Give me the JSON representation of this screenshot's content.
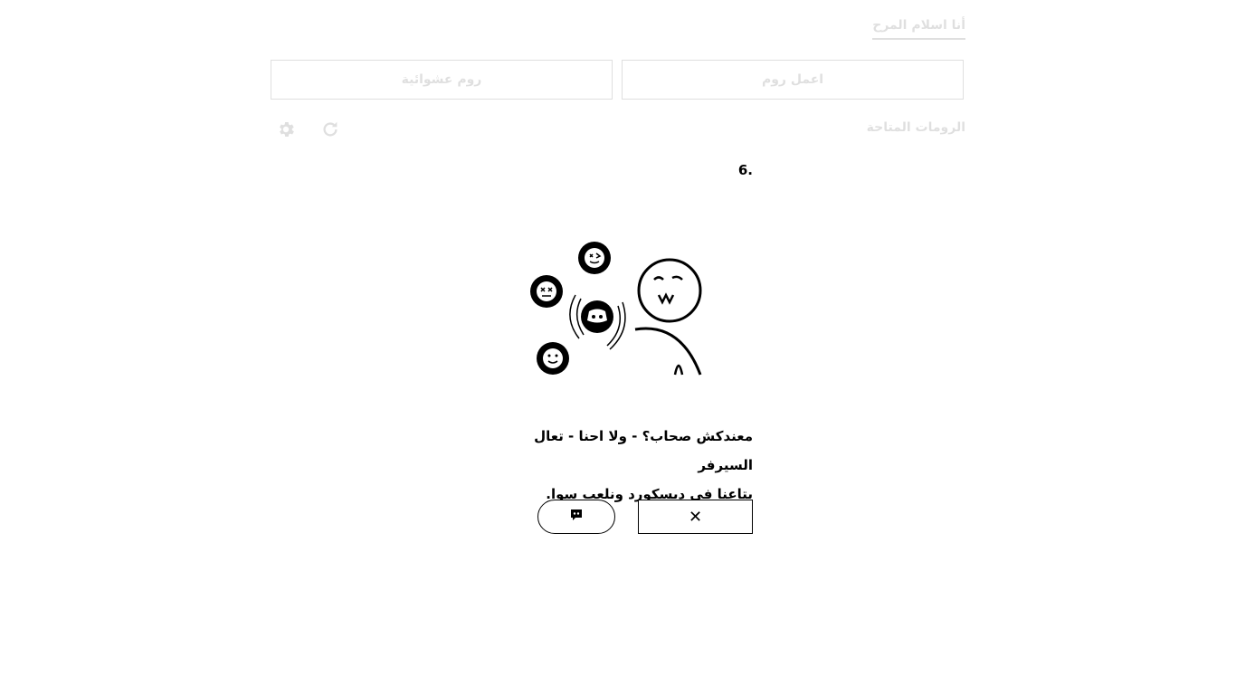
{
  "header": {
    "user_name": "أنا اسلام المرح"
  },
  "actions": {
    "create_room": "اعمل روم",
    "random_room": "روم عشوائية"
  },
  "rooms": {
    "title": "الرومات المتاحة"
  },
  "modal": {
    "index": "6.",
    "message_line1": "معندكش صحاب؟ - ولا احنا - تعال السيرفر",
    "message_line2": "بتاعنا في ديسكورد ونلعب سوا.",
    "close_symbol": "✕"
  },
  "icons": {
    "settings": "gear-icon",
    "refresh": "refresh-icon",
    "close": "close-icon",
    "discord": "discord-icon"
  },
  "colors": {
    "text": "#000000",
    "background": "#ffffff"
  }
}
